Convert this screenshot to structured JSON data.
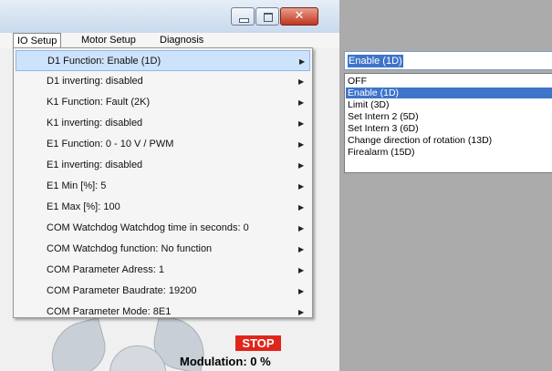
{
  "menubar": {
    "items": [
      "IO Setup",
      "Motor Setup",
      "Diagnosis"
    ]
  },
  "submenu": {
    "items": [
      "D1 Function: Enable (1D)",
      "D1 inverting: disabled",
      "K1 Function: Fault (2K)",
      "K1 inverting: disabled",
      "E1 Function: 0 - 10 V / PWM",
      "E1 inverting: disabled",
      "E1 Min [%]: 5",
      "E1 Max [%]: 100",
      "COM Watchdog Watchdog time in seconds: 0",
      "COM Watchdog function: No function",
      "COM Parameter Adress: 1",
      "COM Parameter Baudrate: 19200",
      "COM Parameter Mode: 8E1"
    ],
    "active_index": 0
  },
  "combo": {
    "value": "Enable (1D)"
  },
  "dropdown": {
    "options": [
      "OFF",
      "Enable (1D)",
      "Limit (3D)",
      "Set Intern 2 (5D)",
      "Set Intern 3 (6D)",
      "Change direction of rotation (13D)",
      "Firealarm (15D)"
    ],
    "selected_index": 1
  },
  "status": {
    "stop_label": "STOP",
    "modulation_text": "Modulation: 0 %"
  },
  "icons": {
    "submenu_arrow": "triangle-right-icon",
    "minimize": "minimize-icon",
    "maximize": "maximize-icon",
    "close": "close-icon"
  },
  "colors": {
    "selection": "#3e74c9",
    "menu_highlight": "#cde2fb",
    "stop": "#e0251b",
    "right_panel": "#ababab"
  }
}
